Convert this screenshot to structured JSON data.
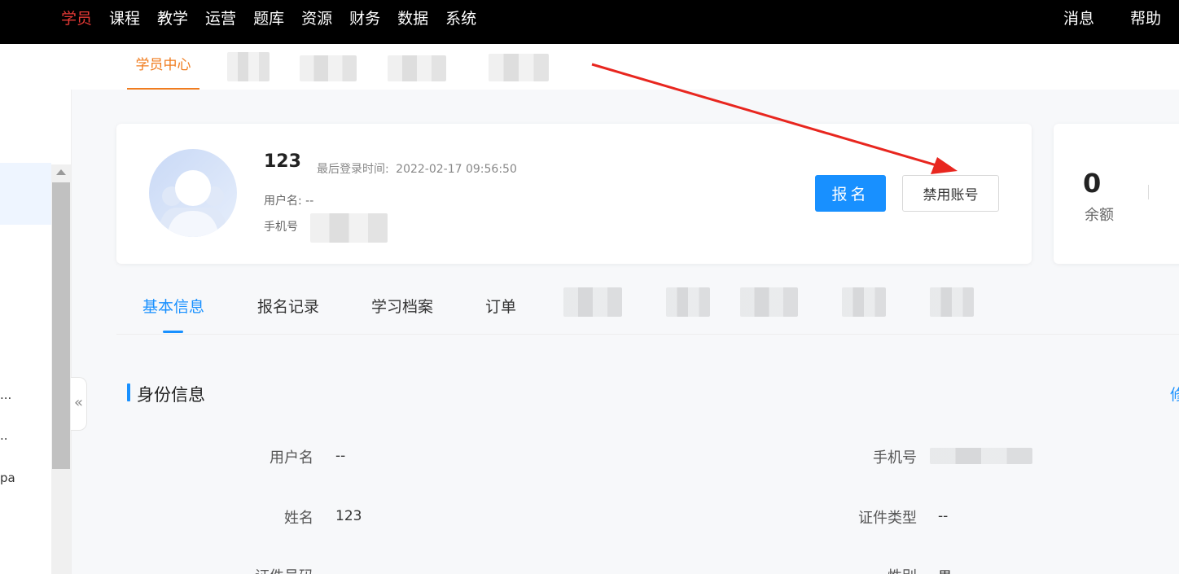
{
  "topnav": {
    "menu": [
      "学员",
      "课程",
      "教学",
      "运营",
      "题库",
      "资源",
      "财务",
      "数据",
      "系统"
    ],
    "active_index": 0,
    "messages": "消息",
    "help": "帮助",
    "active_color": "#e53935"
  },
  "subbar": {
    "active_tab": "学员中心",
    "active_color": "#f07c1f"
  },
  "sidebar": {
    "truncated": [
      "...",
      "..",
      "pa"
    ],
    "collapse_icon": "«"
  },
  "profile": {
    "name": "123",
    "last_login_label": "最后登录时间:",
    "last_login_value": "2022-02-17 09:56:50",
    "username_label": "用户名:",
    "username_value": "--",
    "phone_label": "手机号"
  },
  "actions": {
    "enroll": "报名",
    "disable": "禁用账号",
    "primary_color": "#1890ff"
  },
  "balance": {
    "value": "0",
    "label": "余额"
  },
  "tabs": [
    "基本信息",
    "报名记录",
    "学习档案",
    "订单"
  ],
  "identity": {
    "title": "身份信息",
    "edit": "修",
    "rows": [
      {
        "label": "用户名",
        "value": "--"
      },
      {
        "label": "手机号",
        "value": ""
      },
      {
        "label": "姓名",
        "value": "123"
      },
      {
        "label": "证件类型",
        "value": "--"
      },
      {
        "label": "证件号码",
        "value": ""
      },
      {
        "label": "性别",
        "value": "男"
      }
    ]
  },
  "annotation": {
    "arrow_color": "#e8261f"
  }
}
